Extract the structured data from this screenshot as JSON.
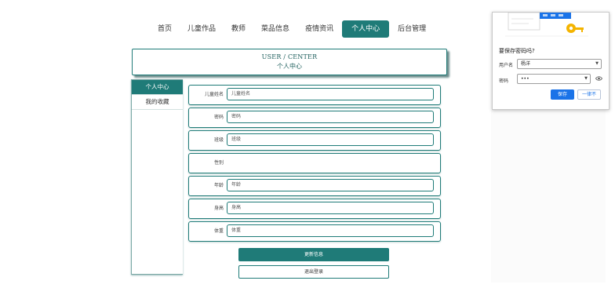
{
  "nav": {
    "items": [
      {
        "label": "首页"
      },
      {
        "label": "儿童作品"
      },
      {
        "label": "教师"
      },
      {
        "label": "菜品信息"
      },
      {
        "label": "疫情资讯"
      },
      {
        "label": "个人中心"
      },
      {
        "label": "后台管理"
      }
    ],
    "active_index": 5
  },
  "header": {
    "title_en": "USER / CENTER",
    "title_cn": "个人中心"
  },
  "sidebar": {
    "items": [
      {
        "label": "个人中心"
      },
      {
        "label": "我的收藏"
      }
    ]
  },
  "form": {
    "fields": [
      {
        "label": "儿童姓名",
        "placeholder": "儿童姓名"
      },
      {
        "label": "密码",
        "placeholder": "密码"
      },
      {
        "label": "班级",
        "placeholder": "班级"
      },
      {
        "label": "性别"
      },
      {
        "label": "年龄",
        "placeholder": "年龄"
      },
      {
        "label": "身高",
        "placeholder": "身高"
      },
      {
        "label": "体重",
        "placeholder": "体重"
      }
    ],
    "update_label": "更新信息",
    "logout_label": "退出登录"
  },
  "password_popup": {
    "title": "要保存密码吗?",
    "username_label": "用户名",
    "username_value": "杨洋",
    "password_label": "密码",
    "password_value": "•••",
    "save_label": "保存",
    "never_label": "一律不"
  },
  "colors": {
    "accent": "#1f7b78",
    "popup_primary": "#1a73e8"
  }
}
